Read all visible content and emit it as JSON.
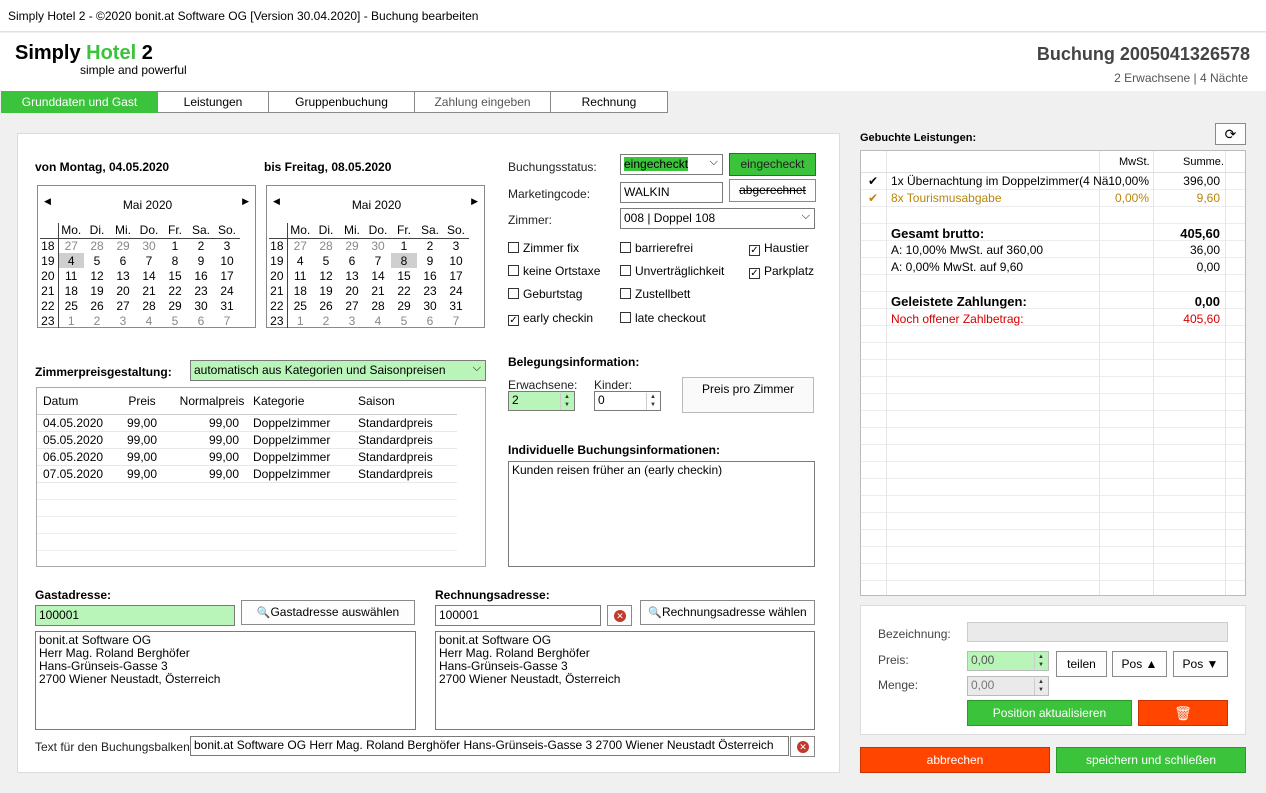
{
  "window_title": "Simply Hotel 2 - ©2020 bonit.at Software OG [Version 30.04.2020] - Buchung bearbeiten",
  "logo": {
    "word1": "Simply",
    "word2": "Hotel",
    "word3": "2",
    "tagline": "simple and powerful"
  },
  "header": {
    "booking_title": "Buchung 2005041326578",
    "booking_sub": "2 Erwachsene | 4 Nächte"
  },
  "tabs": [
    "Grunddaten und Gast",
    "Leistungen",
    "Gruppenbuchung",
    "Zahlung eingeben",
    "Rechnung"
  ],
  "dates": {
    "from_label": "von Montag, 04.05.2020",
    "to_label": "bis Freitag, 08.05.2020"
  },
  "calendar_from": {
    "month": "Mai 2020",
    "days_header": [
      "Mo.",
      "Di.",
      "Mi.",
      "Do.",
      "Fr.",
      "Sa.",
      "So."
    ],
    "weeks": [
      {
        "wk": "18",
        "days": [
          "27",
          "28",
          "29",
          "30",
          "1",
          "2",
          "3"
        ]
      },
      {
        "wk": "19",
        "days": [
          "4",
          "5",
          "6",
          "7",
          "8",
          "9",
          "10"
        ]
      },
      {
        "wk": "20",
        "days": [
          "11",
          "12",
          "13",
          "14",
          "15",
          "16",
          "17"
        ]
      },
      {
        "wk": "21",
        "days": [
          "18",
          "19",
          "20",
          "21",
          "22",
          "23",
          "24"
        ]
      },
      {
        "wk": "22",
        "days": [
          "25",
          "26",
          "27",
          "28",
          "29",
          "30",
          "31"
        ]
      },
      {
        "wk": "23",
        "days": [
          "1",
          "2",
          "3",
          "4",
          "5",
          "6",
          "7"
        ]
      }
    ]
  },
  "calendar_to": {
    "month": "Mai 2020"
  },
  "status": {
    "buchungsstatus_label": "Buchungsstatus:",
    "buchungsstatus_value": "eingecheckt",
    "status_button": "eingecheckt",
    "marketing_label": "Marketingcode:",
    "marketing_value": "WALKIN",
    "abgerechnet_button": "abgerechnet",
    "zimmer_label": "Zimmer:",
    "zimmer_value": "008 | Doppel 108"
  },
  "checkboxes": [
    {
      "label": "Zimmer fix",
      "checked": false
    },
    {
      "label": "barrierefrei",
      "checked": false
    },
    {
      "label": "Haustier",
      "checked": true
    },
    {
      "label": "keine Ortstaxe",
      "checked": false
    },
    {
      "label": "Unverträglichkeit",
      "checked": false
    },
    {
      "label": "Parkplatz",
      "checked": true
    },
    {
      "label": "Geburtstag",
      "checked": false
    },
    {
      "label": "Zustellbett",
      "checked": false
    },
    {
      "label": "early checkin",
      "checked": true
    },
    {
      "label": "late checkout",
      "checked": false
    }
  ],
  "pricing": {
    "label": "Zimmerpreisgestaltung:",
    "mode": "automatisch aus Kategorien und Saisonpreisen",
    "columns": [
      "Datum",
      "Preis",
      "Normalpreis",
      "Kategorie",
      "Saison"
    ],
    "rows": [
      [
        "04.05.2020",
        "99,00",
        "99,00",
        "Doppelzimmer",
        "Standardpreis"
      ],
      [
        "05.05.2020",
        "99,00",
        "99,00",
        "Doppelzimmer",
        "Standardpreis"
      ],
      [
        "06.05.2020",
        "99,00",
        "99,00",
        "Doppelzimmer",
        "Standardpreis"
      ],
      [
        "07.05.2020",
        "99,00",
        "99,00",
        "Doppelzimmer",
        "Standardpreis"
      ]
    ]
  },
  "belegung": {
    "title": "Belegungsinformation:",
    "erwachsene_label": "Erwachsene:",
    "erwachsene_value": "2",
    "kinder_label": "Kinder:",
    "kinder_value": "0",
    "preis_pro_zimmer": "Preis pro Zimmer"
  },
  "individuell": {
    "title": "Individuelle Buchungsinformationen:",
    "text": "Kunden reisen früher an (early checkin)"
  },
  "gast": {
    "label": "Gastadresse:",
    "id": "100001",
    "button": "Gastadresse auswählen",
    "address": [
      "bonit.at Software OG",
      "Herr Mag. Roland Berghöfer",
      "Hans-Grünseis-Gasse 3",
      "2700 Wiener Neustadt, Österreich"
    ]
  },
  "rechnung": {
    "label": "Rechnungsadresse:",
    "id": "100001",
    "button": "Rechnungsadresse wählen",
    "address": [
      "bonit.at Software OG",
      "Herr Mag. Roland Berghöfer",
      "Hans-Grünseis-Gasse 3",
      "2700 Wiener Neustadt, Österreich"
    ]
  },
  "balken": {
    "label": "Text für den Buchungsbalken:",
    "value": "bonit.at Software OG Herr Mag. Roland Berghöfer Hans-Grünseis-Gasse 3 2700 Wiener Neustadt Österreich"
  },
  "leistungen": {
    "title": "Gebuchte Leistungen:",
    "col_mwst": "MwSt.",
    "col_summe": "Summe.",
    "items": [
      {
        "check": "✔",
        "text": "1x Übernachtung im Doppelzimmer(4 Nä...",
        "mwst": "10,00%",
        "summe": "396,00",
        "color": "#000000"
      },
      {
        "check": "✔",
        "text": "8x Tourismusabgabe",
        "mwst": "0,00%",
        "summe": "9,60",
        "color": "#b8860b"
      }
    ],
    "brutto_label": "Gesamt brutto:",
    "brutto_value": "405,60",
    "tax1_label": "A: 10,00% MwSt. auf 360,00",
    "tax1_value": "36,00",
    "tax2_label": "A: 0,00% MwSt. auf 9,60",
    "tax2_value": "0,00",
    "paid_label": "Geleistete Zahlungen:",
    "paid_value": "0,00",
    "open_label": "Noch offener Zahlbetrag:",
    "open_value": "405,60"
  },
  "edit": {
    "bezeichnung_label": "Bezeichnung:",
    "preis_label": "Preis:",
    "preis_value": "0,00",
    "menge_label": "Menge:",
    "menge_value": "0,00",
    "teilen": "teilen",
    "pos_up": "Pos ▲",
    "pos_down": "Pos ▼",
    "update_button": "Position aktualisieren"
  },
  "footer": {
    "cancel": "abbrechen",
    "save": "speichern und schließen"
  },
  "colors": {
    "green": "#3cc33c",
    "light_green": "#b9f5b9",
    "orange": "#ff4500",
    "red_text": "#d40000"
  }
}
